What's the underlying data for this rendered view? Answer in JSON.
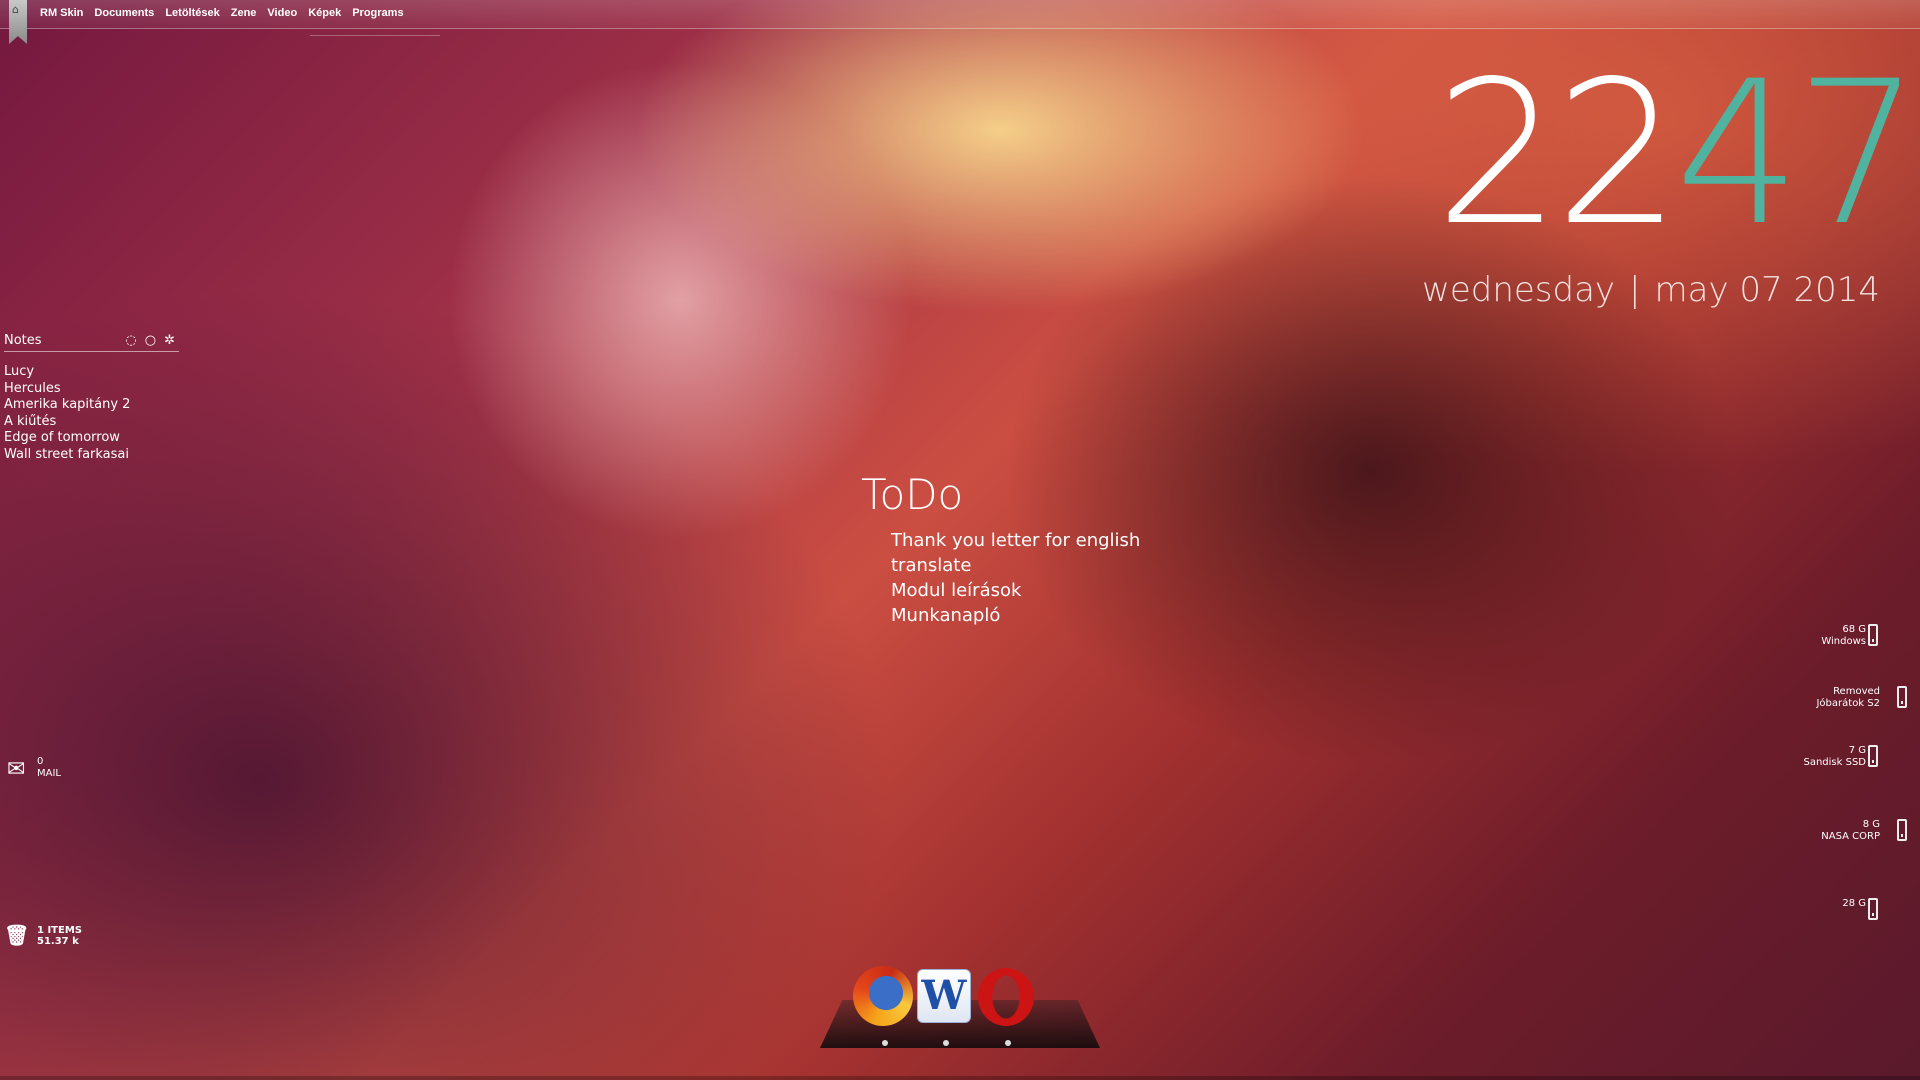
{
  "menubar": {
    "home_icon": "home-icon",
    "items": [
      "RM Skin",
      "Documents",
      "Letöltések",
      "Zene",
      "Video",
      "Képek",
      "Programs"
    ]
  },
  "clock": {
    "hours": "22",
    "minutes": "47",
    "minutes_color": "#4fb3a0"
  },
  "date": {
    "weekday": "wednesday",
    "separator": "|",
    "date": "may 07 2014"
  },
  "notes": {
    "title": "Notes",
    "icons": [
      "refresh-icon",
      "circle-icon",
      "settings-icon"
    ],
    "items": [
      "Lucy",
      "Hercules",
      "Amerika kapitány 2",
      "A kiűtés",
      "Edge of tomorrow",
      "Wall street farkasai"
    ]
  },
  "todo": {
    "title": "ToDo",
    "items": [
      "Thank you letter for english",
      "translate",
      "Modul leírások",
      "Munkanapló"
    ]
  },
  "mail": {
    "count": "0",
    "label": "MAIL"
  },
  "recycle_bin": {
    "items": "1 ITEMS",
    "size": "51.37 k"
  },
  "drives": [
    {
      "size": "68 G",
      "name": "Windows"
    },
    {
      "size": "Removed",
      "name": "Jóbarátok S2"
    },
    {
      "size": "7 G",
      "name": "Sandisk SSD"
    },
    {
      "size": "8 G",
      "name": "NASA CORP"
    },
    {
      "size": "28 G",
      "name": ""
    }
  ],
  "dock": {
    "apps": [
      "firefox-icon",
      "word-icon",
      "opera-icon"
    ]
  }
}
